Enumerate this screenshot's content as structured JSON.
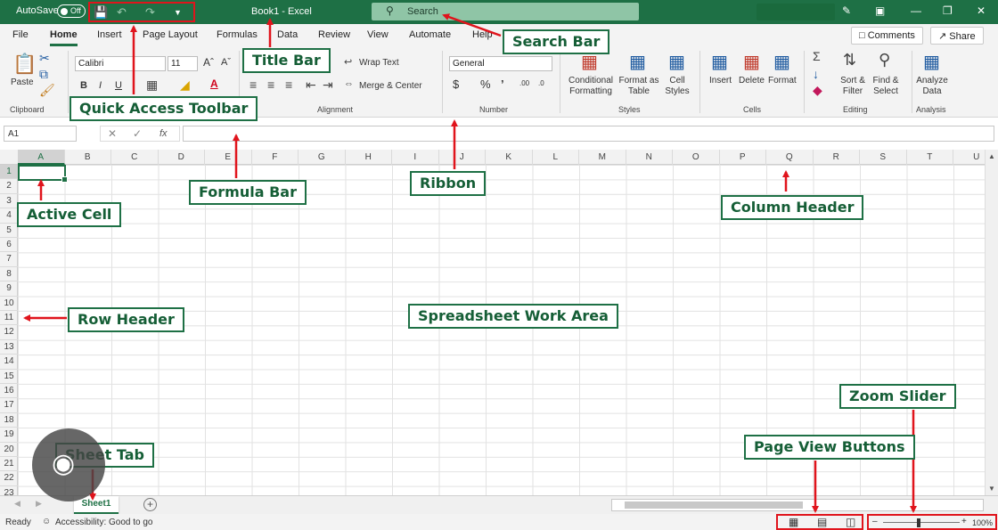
{
  "titlebar": {
    "autosave_label": "AutoSave",
    "autosave_state": "Off",
    "title": "Book1 - Excel",
    "search_placeholder": "Search"
  },
  "menu": {
    "tabs": [
      "File",
      "Home",
      "Insert",
      "Page Layout",
      "Formulas",
      "Data",
      "Review",
      "View",
      "Automate",
      "Help"
    ],
    "active_tab": "Home",
    "comments_label": "Comments",
    "share_label": "Share"
  },
  "ribbon": {
    "clipboard": {
      "paste": "Paste",
      "group": "Clipboard"
    },
    "font": {
      "name": "Calibri",
      "size": "11"
    },
    "alignment": {
      "wrap_text": "Wrap Text",
      "merge_center": "Merge & Center",
      "group": "Alignment"
    },
    "number": {
      "format": "General",
      "group": "Number"
    },
    "styles": {
      "conditional": "Conditional Formatting",
      "format_table": "Format as Table",
      "cell_styles": "Cell Styles",
      "group": "Styles"
    },
    "cells": {
      "insert": "Insert",
      "delete": "Delete",
      "format": "Format",
      "group": "Cells"
    },
    "editing": {
      "sort_filter": "Sort & Filter",
      "find_select": "Find & Select",
      "group": "Editing"
    },
    "analysis": {
      "analyze": "Analyze Data",
      "group": "Analysis"
    }
  },
  "formula_bar": {
    "name_box": "A1",
    "fx": "fx"
  },
  "grid": {
    "columns": [
      "A",
      "B",
      "C",
      "D",
      "E",
      "F",
      "G",
      "H",
      "I",
      "J",
      "K",
      "L",
      "M",
      "N",
      "O",
      "P",
      "Q",
      "R",
      "S",
      "T",
      "U"
    ],
    "rows": [
      "1",
      "2",
      "3",
      "4",
      "5",
      "6",
      "7",
      "8",
      "9",
      "10",
      "11",
      "12",
      "13",
      "14",
      "15",
      "16",
      "17",
      "18",
      "19",
      "20",
      "21",
      "22",
      "23"
    ],
    "active_cell": "A1"
  },
  "sheets": {
    "tabs": [
      "Sheet1"
    ]
  },
  "status": {
    "ready": "Ready",
    "accessibility": "Accessibility: Good to go",
    "zoom": "100%"
  },
  "callouts": {
    "quick_access": "Quick Access Toolbar",
    "title_bar": "Title Bar",
    "search_bar": "Search Bar",
    "formula_bar": "Formula Bar",
    "ribbon": "Ribbon",
    "active_cell": "Active Cell",
    "column_header": "Column Header",
    "row_header": "Row Header",
    "work_area": "Spreadsheet Work Area",
    "sheet_tab": "Sheet Tab",
    "page_view": "Page View Buttons",
    "zoom_slider": "Zoom Slider"
  },
  "colors": {
    "excel_green": "#1e7045",
    "callout_border": "#1e7045",
    "arrow_red": "#e0141c"
  }
}
